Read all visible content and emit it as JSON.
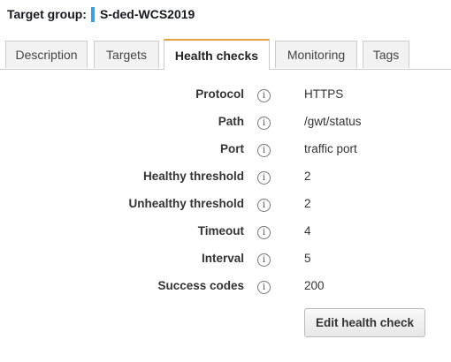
{
  "target_group": {
    "label": "Target group:",
    "name": "S-ded-WCS2019",
    "marker_color": "#3f9fd6"
  },
  "tabs": [
    {
      "label": "Description",
      "active": false
    },
    {
      "label": "Targets",
      "active": false
    },
    {
      "label": "Health checks",
      "active": true
    },
    {
      "label": "Monitoring",
      "active": false
    },
    {
      "label": "Tags",
      "active": false
    }
  ],
  "active_tab_accent": "#e8a03c",
  "info_icon_glyph": "i",
  "health_checks": [
    {
      "label": "Protocol",
      "value": "HTTPS"
    },
    {
      "label": "Path",
      "value": "/gwt/status"
    },
    {
      "label": "Port",
      "value": "traffic port"
    },
    {
      "label": "Healthy threshold",
      "value": "2"
    },
    {
      "label": "Unhealthy threshold",
      "value": "2"
    },
    {
      "label": "Timeout",
      "value": "4"
    },
    {
      "label": "Interval",
      "value": "5"
    },
    {
      "label": "Success codes",
      "value": "200"
    }
  ],
  "edit_button_label": "Edit health check"
}
